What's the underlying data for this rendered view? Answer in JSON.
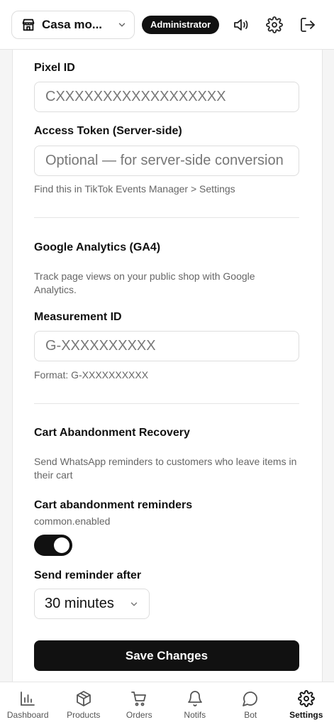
{
  "header": {
    "store_name": "Casa mo...",
    "role_badge": "Administrator"
  },
  "tiktok": {
    "pixel_id_label": "Pixel ID",
    "pixel_id_placeholder": "CXXXXXXXXXXXXXXXXXX",
    "access_token_label": "Access Token (Server-side)",
    "access_token_placeholder": "Optional — for server-side conversion",
    "help": "Find this in TikTok Events Manager > Settings"
  },
  "ga4": {
    "title": "Google Analytics (GA4)",
    "description": "Track page views on your public shop with Google Analytics.",
    "measurement_label": "Measurement ID",
    "measurement_placeholder": "G-XXXXXXXXXX",
    "format_help": "Format: G-XXXXXXXXXX"
  },
  "cart": {
    "title": "Cart Abandonment Recovery",
    "description": "Send WhatsApp reminders to customers who leave items in their cart",
    "reminders_label": "Cart abandonment reminders",
    "enabled_text": "common.enabled",
    "enabled": true,
    "send_after_label": "Send reminder after",
    "send_after_value": "30 minutes"
  },
  "save_label": "Save Changes",
  "nav": {
    "items": [
      {
        "label": "Dashboard",
        "icon": "chart-icon"
      },
      {
        "label": "Products",
        "icon": "box-icon"
      },
      {
        "label": "Orders",
        "icon": "cart-icon"
      },
      {
        "label": "Notifs",
        "icon": "bell-icon"
      },
      {
        "label": "Bot",
        "icon": "chat-icon"
      },
      {
        "label": "Settings",
        "icon": "gear-icon"
      }
    ],
    "active": "Settings"
  }
}
